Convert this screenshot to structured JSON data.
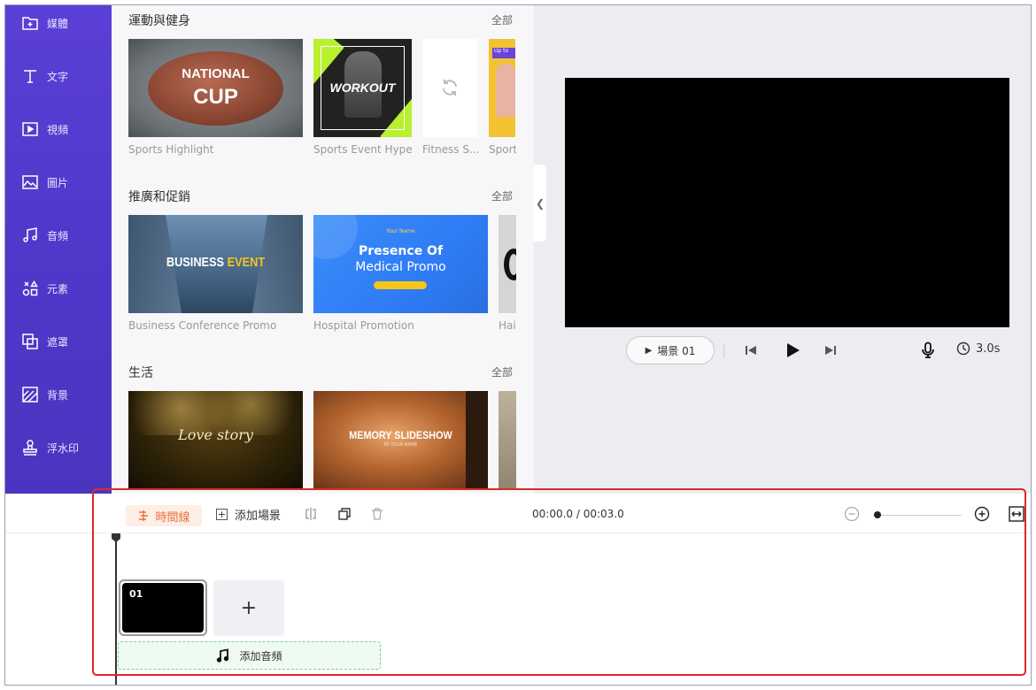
{
  "sidebar": {
    "items": [
      {
        "label": "媒體",
        "icon": "media-upload-icon"
      },
      {
        "label": "文字",
        "icon": "text-icon"
      },
      {
        "label": "視頻",
        "icon": "video-icon"
      },
      {
        "label": "圖片",
        "icon": "image-icon"
      },
      {
        "label": "音頻",
        "icon": "music-icon"
      },
      {
        "label": "元素",
        "icon": "elements-icon"
      },
      {
        "label": "遮罩",
        "icon": "mask-icon"
      },
      {
        "label": "背景",
        "icon": "background-icon"
      },
      {
        "label": "浮水印",
        "icon": "watermark-icon"
      }
    ]
  },
  "templates": {
    "sections": [
      {
        "title": "運動與健身",
        "all": "全部",
        "cards": [
          {
            "caption": "Sports Highlight",
            "text1": "NATIONAL",
            "text2": "CUP"
          },
          {
            "caption": "Sports Event Hype",
            "text1": "WORKOUT"
          },
          {
            "caption": "Fitness S..."
          },
          {
            "caption": "Sport",
            "text1": "Up to"
          }
        ]
      },
      {
        "title": "推廣和促銷",
        "all": "全部",
        "cards": [
          {
            "caption": "Business Conference Promo",
            "text1": "BUSINESS",
            "text2": "EVENT"
          },
          {
            "caption": "Hospital Promotion",
            "text0": "Your Name",
            "text1": "Presence Of",
            "text2": "Medical Promo"
          },
          {
            "caption": "Hai"
          }
        ]
      },
      {
        "title": "生活",
        "all": "全部",
        "cards": [
          {
            "text1": "Love story"
          },
          {
            "text1": "MEMORY SLIDESHOW",
            "text2": "BY YOUR NAME"
          },
          {}
        ]
      }
    ]
  },
  "player": {
    "scene_label": "場景 01",
    "duration": "3.0s"
  },
  "timeline": {
    "tab_label": "時間線",
    "add_scene_label": "添加場景",
    "time_display": "00:00.0 / 00:03.0",
    "scene_number": "01",
    "add_scene_plus": "+",
    "add_audio_label": "添加音頻",
    "zoom_level": 0.05
  },
  "colors": {
    "sidebar": "#5b3fd6",
    "timeline_tab": "#e8733a",
    "highlight": "#e02828",
    "lime": "#b8ef2f",
    "medical_blue": "#2f7cf6"
  }
}
